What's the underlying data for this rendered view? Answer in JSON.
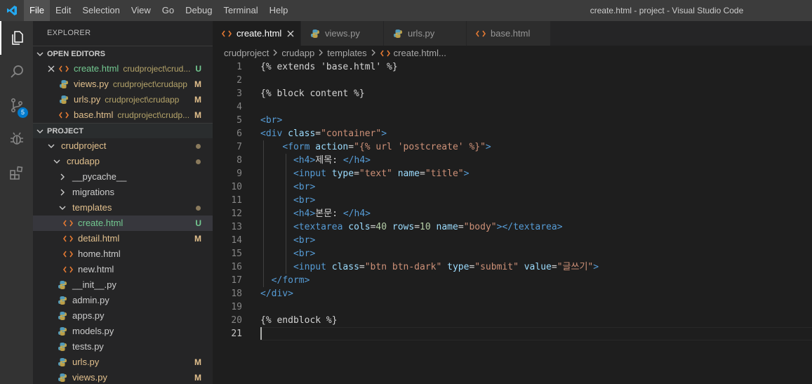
{
  "app": {
    "menu": [
      "File",
      "Edit",
      "Selection",
      "View",
      "Go",
      "Debug",
      "Terminal",
      "Help"
    ],
    "window_title": "create.html - project - Visual Studio Code"
  },
  "activity_bar": {
    "scm_badge": "5"
  },
  "explorer": {
    "title": "EXPLORER",
    "open_editors_label": "OPEN EDITORS",
    "open_editors": [
      {
        "name": "create.html",
        "path": "crudproject\\crud...",
        "status": "U"
      },
      {
        "name": "views.py",
        "path": "crudproject\\crudapp",
        "status": "M"
      },
      {
        "name": "urls.py",
        "path": "crudproject\\crudapp",
        "status": "M"
      },
      {
        "name": "base.html",
        "path": "crudproject\\crudp...",
        "status": "M"
      }
    ],
    "project_label": "PROJECT",
    "tree": [
      {
        "name": "crudproject",
        "kind": "folder-open",
        "depth": 1
      },
      {
        "name": "crudapp",
        "kind": "folder-open",
        "depth": 2
      },
      {
        "name": "__pycache__",
        "kind": "folder-closed",
        "depth": 3
      },
      {
        "name": "migrations",
        "kind": "folder-closed",
        "depth": 3
      },
      {
        "name": "templates",
        "kind": "folder-open",
        "depth": 3
      },
      {
        "name": "create.html",
        "kind": "html",
        "depth": 4,
        "status": "U"
      },
      {
        "name": "detail.html",
        "kind": "html",
        "depth": 4,
        "status": "M"
      },
      {
        "name": "home.html",
        "kind": "html",
        "depth": 4
      },
      {
        "name": "new.html",
        "kind": "html",
        "depth": 4
      },
      {
        "name": "__init__.py",
        "kind": "py",
        "depth": 3
      },
      {
        "name": "admin.py",
        "kind": "py",
        "depth": 3
      },
      {
        "name": "apps.py",
        "kind": "py",
        "depth": 3
      },
      {
        "name": "models.py",
        "kind": "py",
        "depth": 3
      },
      {
        "name": "tests.py",
        "kind": "py",
        "depth": 3
      },
      {
        "name": "urls.py",
        "kind": "py",
        "depth": 3,
        "status": "M"
      },
      {
        "name": "views.py",
        "kind": "py",
        "depth": 3,
        "status": "M"
      }
    ]
  },
  "tabs": [
    {
      "label": "create.html",
      "kind": "html"
    },
    {
      "label": "views.py",
      "kind": "py"
    },
    {
      "label": "urls.py",
      "kind": "py"
    },
    {
      "label": "base.html",
      "kind": "html"
    }
  ],
  "breadcrumb": [
    "crudproject",
    "crudapp",
    "templates",
    "create.html",
    "..."
  ],
  "editor": {
    "lines": [
      [
        [
          "{% extends 'base.html' %}",
          "plain"
        ]
      ],
      [],
      [
        [
          "{% block content %}",
          "plain"
        ]
      ],
      [],
      [
        [
          "<",
          "tag"
        ],
        [
          "br",
          "tagname"
        ],
        [
          ">",
          "tag"
        ]
      ],
      [
        [
          "<",
          "tag"
        ],
        [
          "div",
          "tagname"
        ],
        [
          " class",
          "attr"
        ],
        [
          "=",
          "plain"
        ],
        [
          "\"container\"",
          "str"
        ],
        [
          ">",
          "tag"
        ]
      ],
      [
        [
          "    ",
          "plain"
        ],
        [
          "<",
          "tag"
        ],
        [
          "form",
          "tagname"
        ],
        [
          " action",
          "attr"
        ],
        [
          "=",
          "plain"
        ],
        [
          "\"{% url 'postcreate' %}\"",
          "str"
        ],
        [
          ">",
          "tag"
        ]
      ],
      [
        [
          "      ",
          "plain"
        ],
        [
          "<",
          "tag"
        ],
        [
          "h4",
          "tagname"
        ],
        [
          ">",
          "tag"
        ],
        [
          "제목: ",
          "plain"
        ],
        [
          "</",
          "tag"
        ],
        [
          "h4",
          "tagname"
        ],
        [
          ">",
          "tag"
        ]
      ],
      [
        [
          "      ",
          "plain"
        ],
        [
          "<",
          "tag"
        ],
        [
          "input",
          "tagname"
        ],
        [
          " type",
          "attr"
        ],
        [
          "=",
          "plain"
        ],
        [
          "\"text\"",
          "str"
        ],
        [
          " name",
          "attr"
        ],
        [
          "=",
          "plain"
        ],
        [
          "\"title\"",
          "str"
        ],
        [
          ">",
          "tag"
        ]
      ],
      [
        [
          "      ",
          "plain"
        ],
        [
          "<",
          "tag"
        ],
        [
          "br",
          "tagname"
        ],
        [
          ">",
          "tag"
        ]
      ],
      [
        [
          "      ",
          "plain"
        ],
        [
          "<",
          "tag"
        ],
        [
          "br",
          "tagname"
        ],
        [
          ">",
          "tag"
        ]
      ],
      [
        [
          "      ",
          "plain"
        ],
        [
          "<",
          "tag"
        ],
        [
          "h4",
          "tagname"
        ],
        [
          ">",
          "tag"
        ],
        [
          "본문: ",
          "plain"
        ],
        [
          "</",
          "tag"
        ],
        [
          "h4",
          "tagname"
        ],
        [
          ">",
          "tag"
        ]
      ],
      [
        [
          "      ",
          "plain"
        ],
        [
          "<",
          "tag"
        ],
        [
          "textarea",
          "tagname"
        ],
        [
          " cols",
          "attr"
        ],
        [
          "=",
          "plain"
        ],
        [
          "40",
          "num"
        ],
        [
          " rows",
          "attr"
        ],
        [
          "=",
          "plain"
        ],
        [
          "10",
          "num"
        ],
        [
          " name",
          "attr"
        ],
        [
          "=",
          "plain"
        ],
        [
          "\"body\"",
          "str"
        ],
        [
          "></",
          "tag"
        ],
        [
          "textarea",
          "tagname"
        ],
        [
          ">",
          "tag"
        ]
      ],
      [
        [
          "      ",
          "plain"
        ],
        [
          "<",
          "tag"
        ],
        [
          "br",
          "tagname"
        ],
        [
          ">",
          "tag"
        ]
      ],
      [
        [
          "      ",
          "plain"
        ],
        [
          "<",
          "tag"
        ],
        [
          "br",
          "tagname"
        ],
        [
          ">",
          "tag"
        ]
      ],
      [
        [
          "      ",
          "plain"
        ],
        [
          "<",
          "tag"
        ],
        [
          "input",
          "tagname"
        ],
        [
          " class",
          "attr"
        ],
        [
          "=",
          "plain"
        ],
        [
          "\"btn btn-dark\"",
          "str"
        ],
        [
          " type",
          "attr"
        ],
        [
          "=",
          "plain"
        ],
        [
          "\"submit\"",
          "str"
        ],
        [
          " value",
          "attr"
        ],
        [
          "=",
          "plain"
        ],
        [
          "\"글쓰기\"",
          "str"
        ],
        [
          ">",
          "tag"
        ]
      ],
      [
        [
          "  ",
          "plain"
        ],
        [
          "</",
          "tag"
        ],
        [
          "form",
          "tagname"
        ],
        [
          ">",
          "tag"
        ]
      ],
      [
        [
          "</",
          "tag"
        ],
        [
          "div",
          "tagname"
        ],
        [
          ">",
          "tag"
        ]
      ],
      [],
      [
        [
          "{% endblock %}",
          "plain"
        ]
      ],
      []
    ],
    "cursor_line": 21
  },
  "colors": {
    "modified": "#e2c08d",
    "untracked": "#73c991",
    "accent": "#007acc",
    "html_icon": "#e37933",
    "py_icon": "#519aba"
  }
}
